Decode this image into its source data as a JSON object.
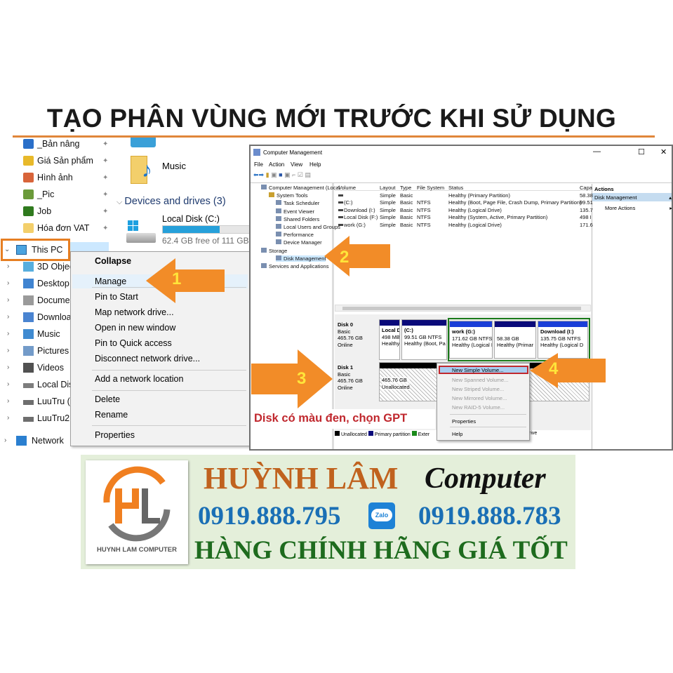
{
  "title": "TẠO PHÂN VÙNG MỚI TRƯỚC KHI SỬ DỤNG",
  "explorer": {
    "quick_access": [
      {
        "label": "_Bản nâng",
        "icon": "pin-star-icon"
      },
      {
        "label": "Giá Sản phẩm",
        "icon": "star-icon"
      },
      {
        "label": "Hình ảnh",
        "icon": "photos-icon"
      },
      {
        "label": "_Pic",
        "icon": "image-icon"
      },
      {
        "label": "Job",
        "icon": "tree-icon"
      },
      {
        "label": "Hóa đơn VAT",
        "icon": "folder-icon"
      }
    ],
    "this_pc": "This PC",
    "this_pc_children": [
      "3D Objec",
      "Desktop",
      "Documer",
      "Downloa",
      "Music",
      "Pictures",
      "Videos",
      "Local Dis",
      "LuuTru (D",
      "LuuTru2 ("
    ],
    "network": "Network",
    "folder_music": "Music",
    "devices_header": "Devices and drives (3)",
    "drive_name": "Local Disk (C:)",
    "drive_free": "62.4 GB free of 111 GB",
    "drive_used_fraction": 0.44,
    "drive_bar_color": "#26a0da"
  },
  "context_menu": {
    "items": [
      "Collapse",
      "Manage",
      "Pin to Start",
      "Map network drive...",
      "Open in new window",
      "Pin to Quick access",
      "Disconnect network drive...",
      "Add a network location",
      "Delete",
      "Rename",
      "Properties"
    ]
  },
  "steps": [
    "1",
    "2",
    "3",
    "4"
  ],
  "mmc": {
    "title": "Computer Management",
    "menu": [
      "File",
      "Action",
      "View",
      "Help"
    ],
    "tree": [
      "Computer Management (Local",
      "System Tools",
      "Task Scheduler",
      "Event Viewer",
      "Shared Folders",
      "Local Users and Groups",
      "Performance",
      "Device Manager",
      "Storage",
      "Disk Management",
      "Services and Applications"
    ],
    "columns": [
      "Volume",
      "Layout",
      "Type",
      "File System",
      "Status",
      "Capa"
    ],
    "rows": [
      [
        "",
        "Simple",
        "Basic",
        "",
        "Healthy (Primary Partition)",
        "58.38"
      ],
      [
        "(C:)",
        "Simple",
        "Basic",
        "NTFS",
        "Healthy (Boot, Page File, Crash Dump, Primary Partition)",
        "99.51"
      ],
      [
        "Download (I:)",
        "Simple",
        "Basic",
        "NTFS",
        "Healthy (Logical Drive)",
        "135.7"
      ],
      [
        "Local Disk (F:)",
        "Simple",
        "Basic",
        "NTFS",
        "Healthy (System, Active, Primary Partition)",
        "498 I"
      ],
      [
        "work (G:)",
        "Simple",
        "Basic",
        "NTFS",
        "Healthy (Logical Drive)",
        "171.6"
      ]
    ],
    "actions_header": "Actions",
    "actions_section": "Disk Management",
    "actions_more": "More Actions",
    "disk0": {
      "name": "Disk 0",
      "type": "Basic",
      "size": "465.76 GB",
      "state": "Online",
      "parts": [
        {
          "name": "Local D",
          "size": "498 MB",
          "status": "Healthy"
        },
        {
          "name": "(C:)",
          "size": "99.51 GB NTFS",
          "status": "Healthy (Boot, Pa"
        },
        {
          "name": "work  (G:)",
          "size": "171.62 GB NTFS",
          "status": "Healthy (Logical I"
        },
        {
          "name": "",
          "size": "58.38 GB",
          "status": "Healthy (Primar"
        },
        {
          "name": "Download  (I:)",
          "size": "135.75 GB NTFS",
          "status": "Healthy (Logical D"
        }
      ]
    },
    "disk1": {
      "name": "Disk 1",
      "type": "Basic",
      "size": "465.76 GB",
      "state": "Online",
      "unalloc_size": "465.76 GB",
      "unalloc_label": "Unallocated"
    },
    "legend": [
      "Unallocated",
      "Primary partition",
      "Exter",
      "rive"
    ],
    "disk_menu": [
      "New Simple Volume...",
      "New Spanned Volume...",
      "New Striped Volume...",
      "New Mirrored Volume...",
      "New RAID-5 Volume...",
      "Properties",
      "Help"
    ]
  },
  "note": "Disk có màu đen, chọn GPT",
  "banner": {
    "brand": "HUỲNH LÂM",
    "brand2": "Computer",
    "phone1": "0919.888.795",
    "phone2": "0919.888.783",
    "zalo": "Zalo",
    "slogan": "HÀNG CHÍNH HÃNG GIÁ TỐT",
    "logo_text": "HUYNH LAM COMPUTER",
    "logo_letters": "HL"
  },
  "colors": {
    "accent": "#e67e22",
    "brand": "#c0621e",
    "phone": "#1a6fb5",
    "slogan": "#1e6b1e",
    "note": "#c0282e"
  }
}
